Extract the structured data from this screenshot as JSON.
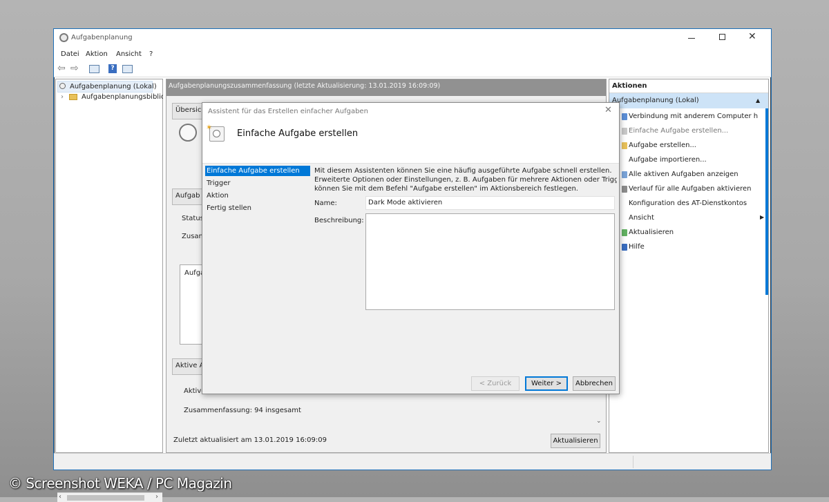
{
  "window": {
    "title": "Aufgabenplanung",
    "menu": [
      "Datei",
      "Aktion",
      "Ansicht",
      "?"
    ]
  },
  "tree": {
    "root": "Aufgabenplanung (Lokal)",
    "child": "Aufgabenplanungsbibliot"
  },
  "center": {
    "header": "Aufgabenplanungszusammenfassung (letzte Aktualisierung: 13.01.2019 16:09:09)",
    "overview_label": "Übersich",
    "tasks_label": "Aufgab",
    "status_label": "Status",
    "zusam_label": "Zusam",
    "box_label": "Aufga",
    "active_label": "Aktive A",
    "active_row": "Aktive",
    "summary": "Zusammenfassung: 94 insgesamt",
    "last_updated": "Zuletzt aktualisiert am 13.01.2019 16:09:09",
    "refresh_button": "Aktualisieren"
  },
  "actions": {
    "title": "Aktionen",
    "section": "Aufgabenplanung (Lokal)",
    "items": [
      {
        "label": "Verbindung mit anderem Computer h",
        "icon": "computer-icon"
      },
      {
        "label": "Einfache Aufgabe erstellen...",
        "icon": "task-icon"
      },
      {
        "label": "Aufgabe erstellen...",
        "icon": "task-icon"
      },
      {
        "label": "Aufgabe importieren...",
        "icon": "import-icon"
      },
      {
        "label": "Alle aktiven Aufgaben anzeigen",
        "icon": "list-icon"
      },
      {
        "label": "Verlauf für alle Aufgaben aktivieren",
        "icon": "history-icon"
      },
      {
        "label": "Konfiguration des AT-Dienstkontos",
        "icon": "config-icon"
      },
      {
        "label": "Ansicht",
        "icon": "view-icon"
      },
      {
        "label": "Aktualisieren",
        "icon": "refresh-icon"
      },
      {
        "label": "Hilfe",
        "icon": "help-icon"
      }
    ]
  },
  "dialog": {
    "title": "Assistent für das Erstellen einfacher Aufgaben",
    "heading": "Einfache Aufgabe erstellen",
    "steps": [
      "Einfache Aufgabe erstellen",
      "Trigger",
      "Aktion",
      "Fertig stellen"
    ],
    "description_line1": "Mit diesem Assistenten können Sie eine häufig ausgeführte Aufgabe schnell erstellen.",
    "description_line2": "Erweiterte Optionen oder Einstellungen, z. B. Aufgaben für mehrere Aktionen oder Trigger,",
    "description_line3": "können Sie mit dem Befehl \"Aufgabe erstellen\" im Aktionsbereich festlegen.",
    "name_label": "Name:",
    "name_value": "Dark Mode aktivieren",
    "description_label": "Beschreibung:",
    "description_value": "",
    "back_button": "< Zurück",
    "next_button": "Weiter >",
    "cancel_button": "Abbrechen"
  },
  "watermark": "© Screenshot WEKA / PC Magazin",
  "colors": {
    "accent": "#0078d7",
    "selection": "#cde3f7",
    "header_gray": "#919191"
  }
}
